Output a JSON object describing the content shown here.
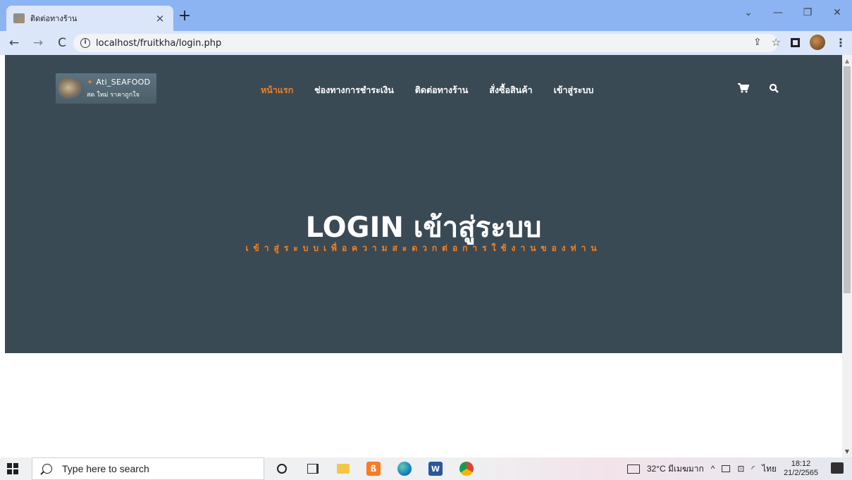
{
  "browser": {
    "tab_title": "ติดต่อทางร้าน",
    "tab_close": "×",
    "new_tab": "+",
    "url": "localhost/fruitkha/login.php",
    "window_controls": [
      "minimize-icon",
      "restore-icon",
      "close-icon"
    ]
  },
  "site": {
    "logo_brand": "Ati_SEAFOOD",
    "logo_tagline": "สด ใหม่ ราคาถูกใจ",
    "nav": [
      {
        "label": "หน้าแรก",
        "active": true
      },
      {
        "label": "ช่องทางการชำระเงิน",
        "active": false
      },
      {
        "label": "ติดต่อทางร้าน",
        "active": false
      },
      {
        "label": "สั่งซื้อสินค้า",
        "active": false
      },
      {
        "label": "เข้าสู่ระบบ",
        "active": false
      }
    ],
    "icons": [
      "cart-icon",
      "search-icon"
    ],
    "hero_title": "LOGIN เข้าสู่ระบบ",
    "hero_subtitle": "เข้าสู่ระบบเพื่อความสะดวกต่อการใช้งานของท่าน",
    "colors": {
      "hero_bg": "#3a4a55",
      "accent": "#f28123",
      "text": "#ffffff"
    }
  },
  "taskbar": {
    "search_placeholder": "Type here to search",
    "weather": "32°C มีเมฆมาก",
    "language": "ไทย",
    "time": "18:12",
    "date": "21/2/2565"
  }
}
